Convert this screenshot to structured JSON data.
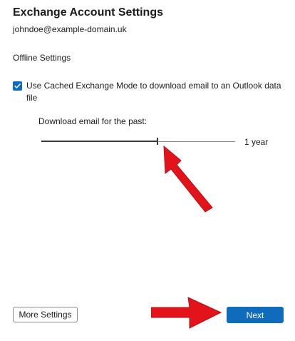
{
  "header": {
    "title": "Exchange Account Settings",
    "email": "johndoe@example-domain.uk"
  },
  "offline": {
    "section_title": "Offline Settings",
    "cached_mode_label": "Use Cached Exchange Mode to download email to an Outlook data file",
    "cached_mode_checked": true,
    "download_label": "Download email for the past:",
    "slider_value_label": "1 year",
    "slider_fraction": 0.6
  },
  "footer": {
    "more_settings_label": "More Settings",
    "next_label": "Next"
  },
  "colors": {
    "accent": "#0f6cbd",
    "annotation_arrow": "#e3131b"
  },
  "annotations": {
    "arrow_to_slider_icon": "red-arrow-icon",
    "arrow_to_next_icon": "red-arrow-icon"
  }
}
